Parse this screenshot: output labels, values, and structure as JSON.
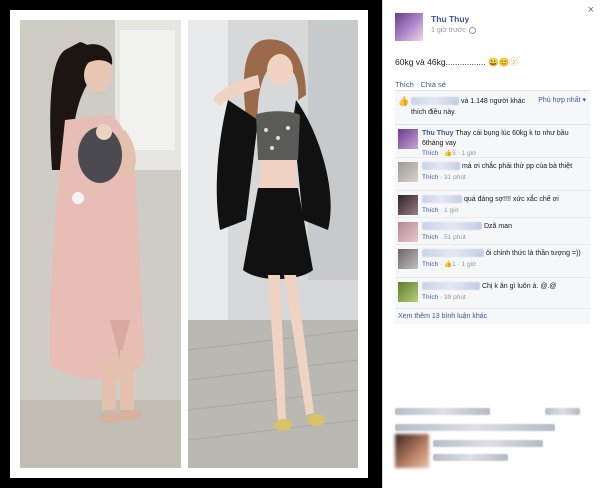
{
  "window": {
    "close_label": "×"
  },
  "post": {
    "author": "Thu Thuy",
    "time": "1 giờ trước",
    "caption": "60kg và 46kg.................",
    "caption_emoji": "😀😊㋡"
  },
  "actions": {
    "like": "Thích",
    "sep": "·",
    "share": "Chia sẻ"
  },
  "likes": {
    "text_suffix": "và 1.148 người khác thích điều này.",
    "sort_label": "Phù hợp nhất ▾"
  },
  "comments": [
    {
      "name": "Thu Thuy",
      "text": "Thay cái bụng lúc 60kg k to như bầu 6tháng vay",
      "meta_like": "Thích",
      "likes": "5",
      "time": "1 giờ"
    },
    {
      "text": "mà ơi chắc phải thử pp của bà thiệt",
      "meta_like": "Thích",
      "time": "31 phút"
    },
    {
      "text": "quá đáng sợ!!!! xức xắc chế ơi",
      "meta_like": "Thích",
      "time": "1 giờ"
    },
    {
      "text": "Dzã man",
      "meta_like": "Thích",
      "time": "51 phút"
    },
    {
      "text": "ôi chỉnh thức là thần tượng =))",
      "meta_like": "Thích",
      "likes": "1",
      "time": "1 giờ"
    },
    {
      "text": "Chị k ăn gì luôn á. @.@",
      "meta_like": "Thích",
      "time": "39 phút"
    }
  ],
  "more_comments": "Xem thêm 13 bình luận khác"
}
